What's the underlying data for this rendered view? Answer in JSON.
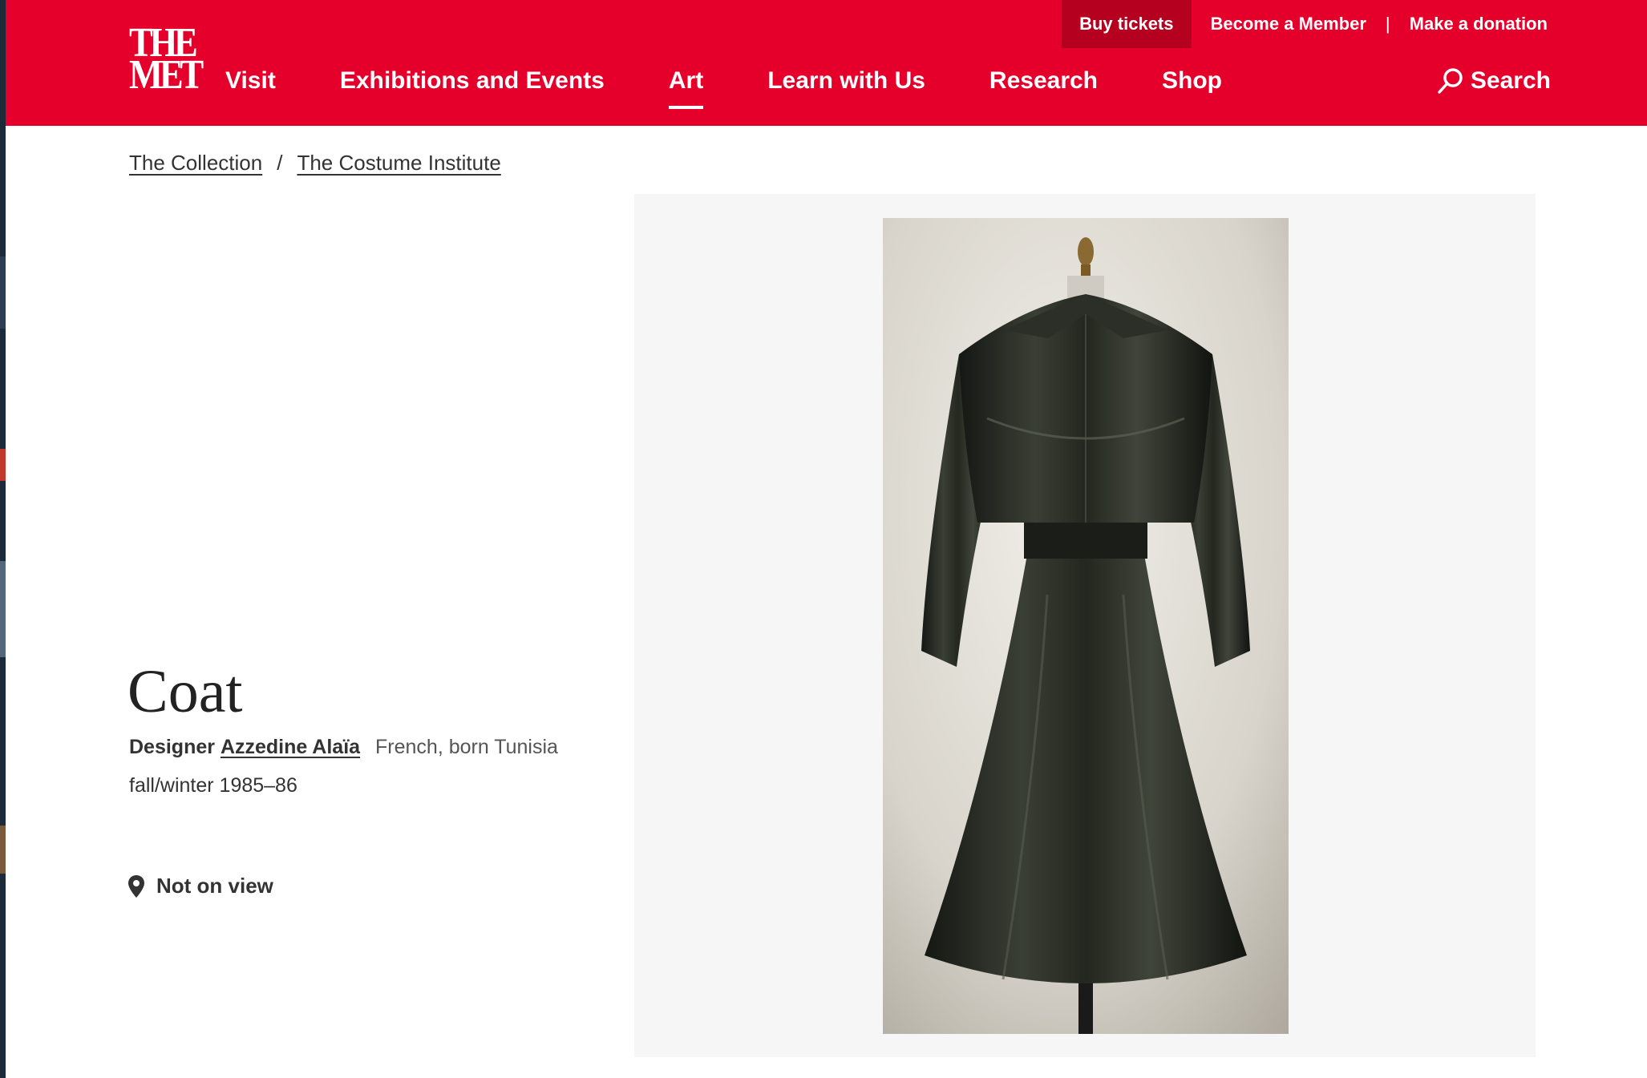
{
  "header": {
    "logo_line1": "THE",
    "logo_line2": "MET",
    "utility": {
      "buy_tickets": "Buy tickets",
      "become_member": "Become a Member",
      "separator": "|",
      "donation": "Make a donation"
    },
    "nav": [
      {
        "label": "Visit"
      },
      {
        "label": "Exhibitions and Events"
      },
      {
        "label": "Art",
        "active": true
      },
      {
        "label": "Learn with Us"
      },
      {
        "label": "Research"
      },
      {
        "label": "Shop"
      }
    ],
    "search_label": "Search",
    "brand_color": "#e4002b"
  },
  "breadcrumb": {
    "items": [
      "The Collection",
      "The Costume Institute"
    ],
    "separator": "/"
  },
  "object": {
    "title": "Coat",
    "role": "Designer",
    "designer": "Azzedine Alaïa",
    "nationality": "French, born Tunisia",
    "date": "fall/winter 1985–86",
    "view_status": "Not on view"
  },
  "image": {
    "subject": "black leather coat on dress form, back view"
  },
  "icons": [
    "search-icon",
    "location-pin-icon"
  ]
}
